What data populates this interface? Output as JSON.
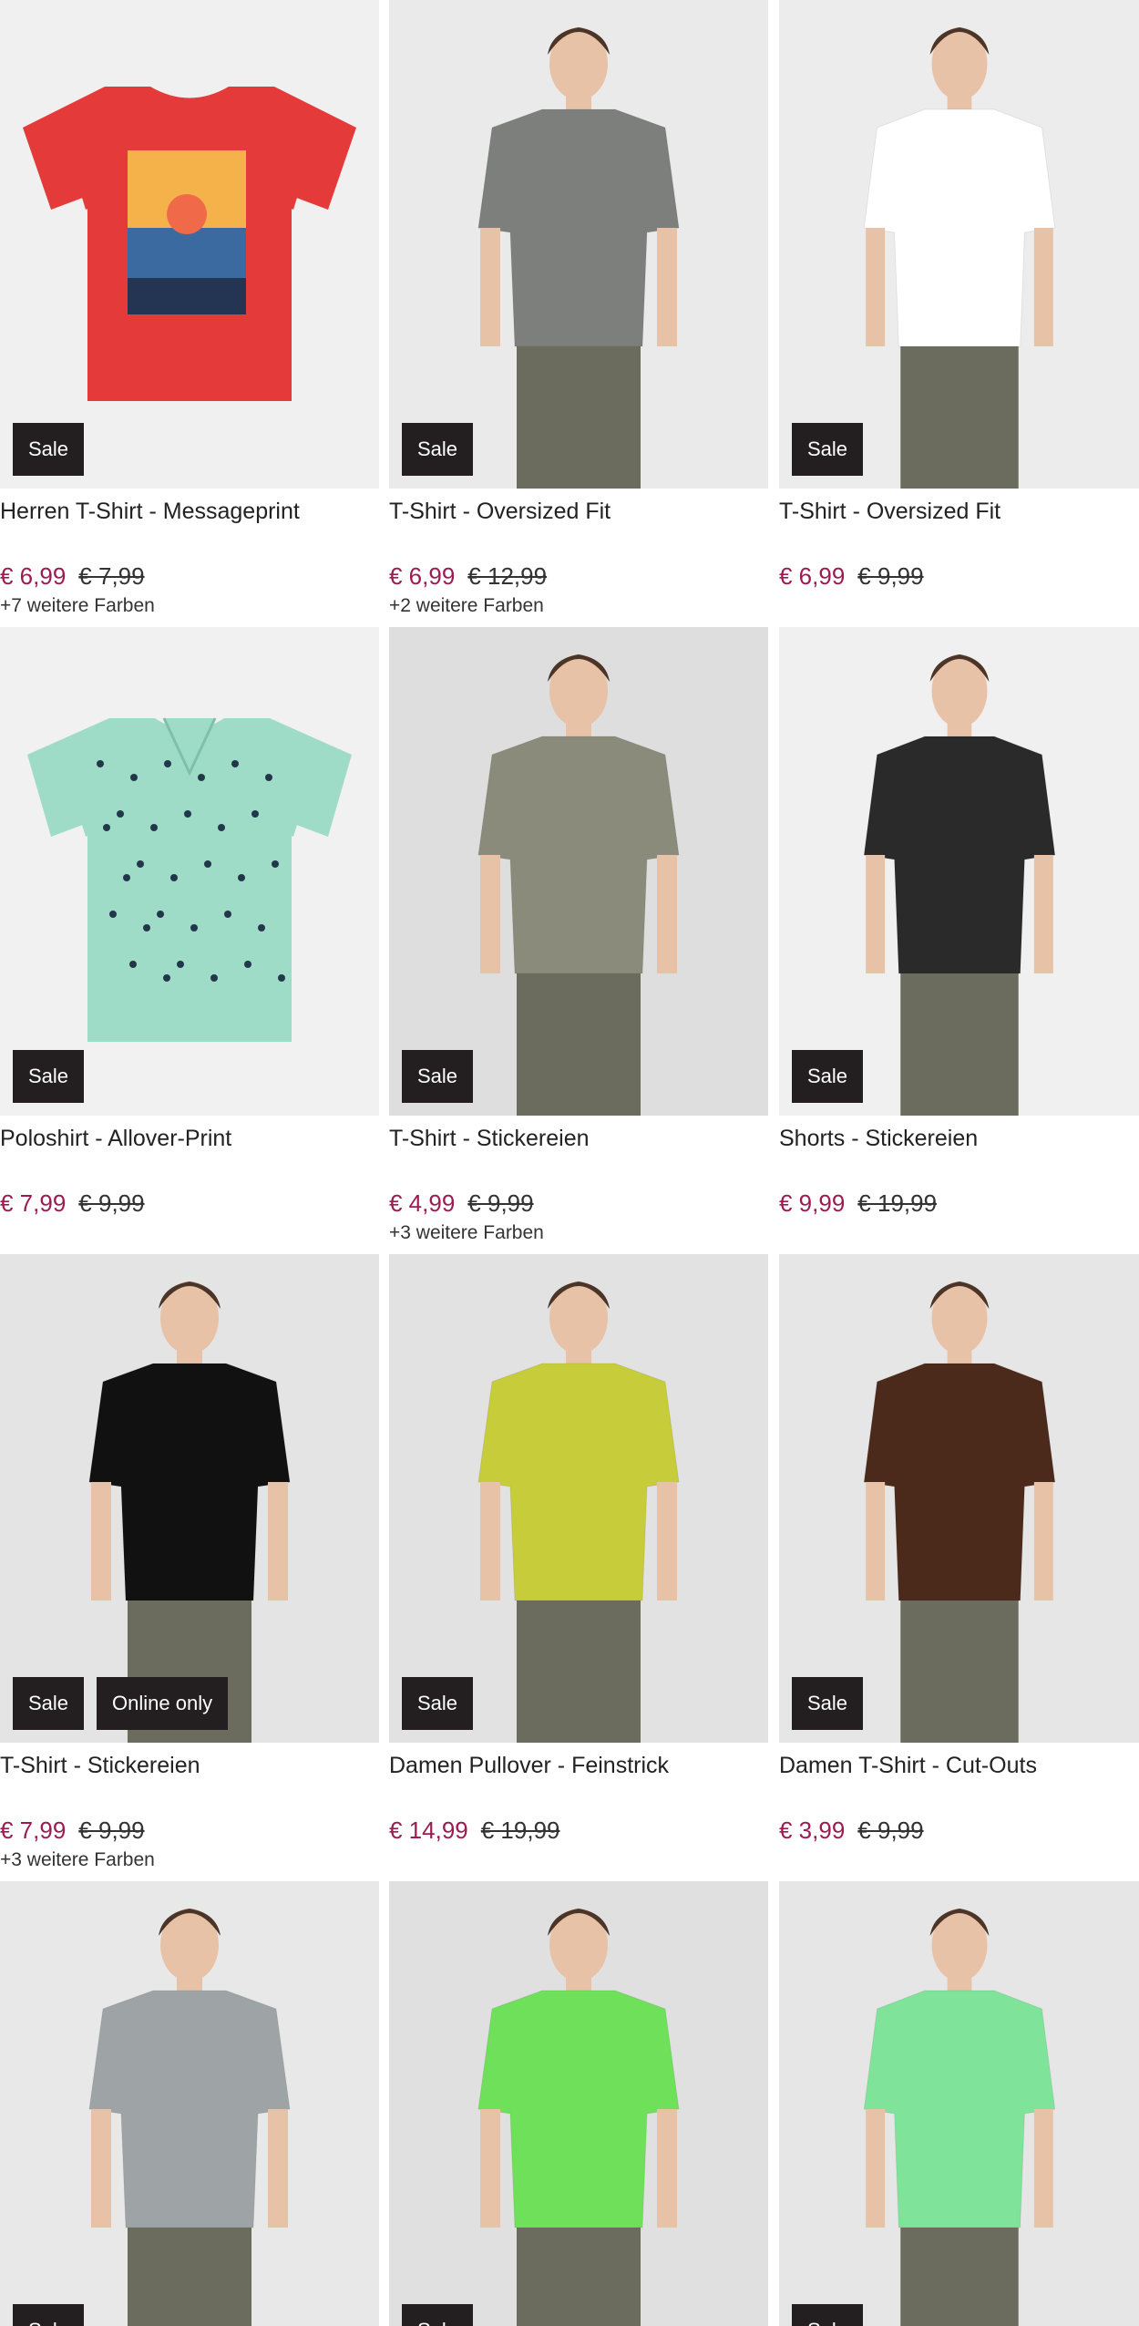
{
  "sale_label": "Sale",
  "online_label": "Online only",
  "products": [
    {
      "title": "Herren T-Shirt - Messageprint",
      "price": "€ 6,99",
      "old_price": "€ 7,99",
      "colors": "+7 weitere Farben",
      "badge": "Sale",
      "bg": "#f0f0f0",
      "garment": "#e53a3a",
      "image": "red-tshirt-los-angeles"
    },
    {
      "title": "T-Shirt - Oversized Fit",
      "price": "€ 6,99",
      "old_price": "€ 12,99",
      "colors": "+2 weitere Farben",
      "badge": "Sale",
      "bg": "#eaeaea",
      "garment": "#7d7f7c",
      "image": "grey-tshirt-man"
    },
    {
      "title": "T-Shirt - Oversized Fit",
      "price": "€ 6,99",
      "old_price": "€ 9,99",
      "colors": "",
      "badge": "Sale",
      "bg": "#ececec",
      "garment": "#ffffff",
      "image": "white-tshirt-woman"
    },
    {
      "title": "Poloshirt - Allover-Print",
      "price": "€ 7,99",
      "old_price": "€ 9,99",
      "colors": "",
      "badge": "Sale",
      "bg": "#f1f1f1",
      "garment": "#9fdcc8",
      "image": "mint-polo"
    },
    {
      "title": "T-Shirt - Stickereien",
      "price": "€ 4,99",
      "old_price": "€ 9,99",
      "colors": "+3 weitere Farben",
      "badge": "Sale",
      "bg": "#dedede",
      "garment": "#8b8b7c",
      "image": "olive-tshirt-woman"
    },
    {
      "title": "Shorts - Stickereien",
      "price": "€ 9,99",
      "old_price": "€ 19,99",
      "colors": "",
      "badge": "Sale",
      "bg": "#f0f0f0",
      "garment": "#2a2a2a",
      "image": "black-shorts-man"
    },
    {
      "title": "T-Shirt - Stickereien",
      "price": "€ 7,99",
      "old_price": "€ 9,99",
      "colors": "+3 weitere Farben",
      "badge": "Sale",
      "badge2": "Online only",
      "bg": "#e4e4e4",
      "garment": "#111111",
      "image": "black-tshirt-woman"
    },
    {
      "title": "Damen Pullover - Feinstrick",
      "price": "€ 14,99",
      "old_price": "€ 19,99",
      "colors": "",
      "badge": "Sale",
      "bg": "#e2e2e2",
      "garment": "#c7cc3a",
      "image": "lime-pullover-woman"
    },
    {
      "title": "Damen T-Shirt - Cut-Outs",
      "price": "€ 3,99",
      "old_price": "€ 9,99",
      "colors": "",
      "badge": "Sale",
      "bg": "#e6e6e6",
      "garment": "#4b2a1c",
      "image": "brown-top-woman"
    },
    {
      "title": "",
      "price": "",
      "old_price": "",
      "colors": "",
      "badge": "Sale",
      "bg": "#e8e8e8",
      "garment": "#9ea4a6",
      "image": "grey-shirt-man"
    },
    {
      "title": "",
      "price": "",
      "old_price": "",
      "colors": "",
      "badge": "Sale",
      "bg": "#e0e0e0",
      "garment": "#6fe05a",
      "image": "green-tank-man"
    },
    {
      "title": "",
      "price": "",
      "old_price": "",
      "colors": "",
      "badge": "Sale",
      "bg": "#e6e6e6",
      "garment": "#7fe39a",
      "image": "green-print-tshirt-woman"
    }
  ]
}
